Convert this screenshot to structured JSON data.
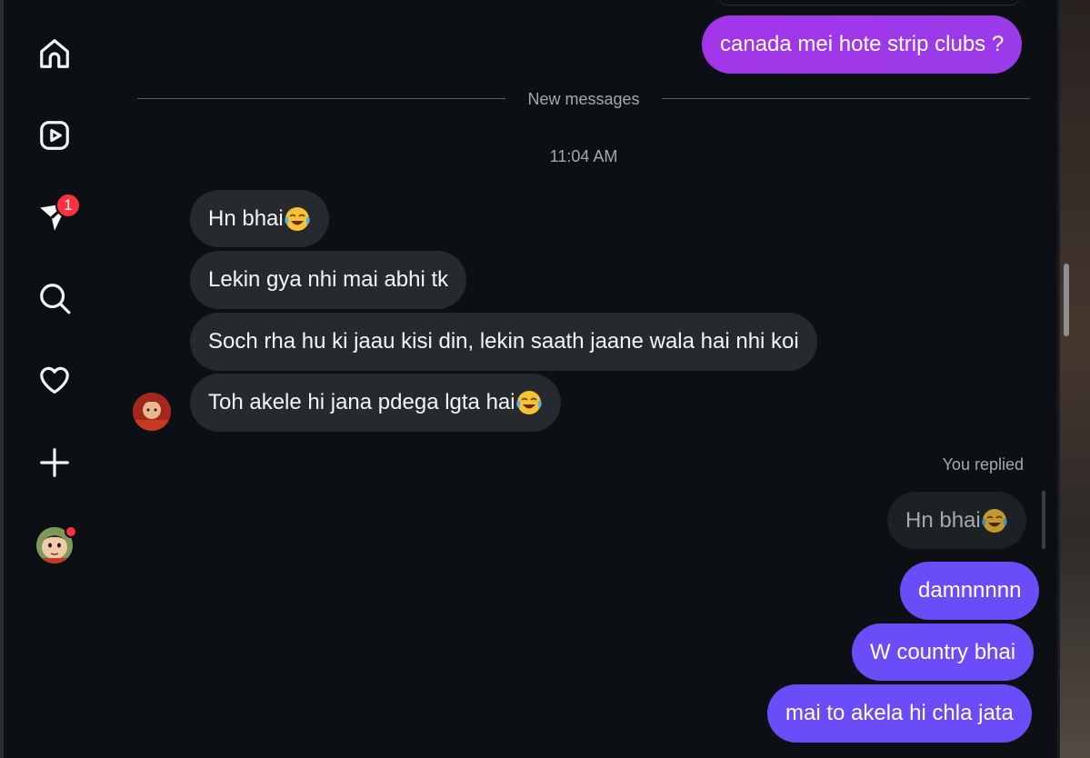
{
  "sidebar": {
    "items": [
      {
        "icon": "home-icon"
      },
      {
        "icon": "reels-icon"
      },
      {
        "icon": "messages-icon",
        "badge": "1"
      },
      {
        "icon": "search-icon"
      },
      {
        "icon": "heart-icon"
      },
      {
        "icon": "create-icon"
      },
      {
        "icon": "profile-avatar"
      }
    ]
  },
  "chat": {
    "sent_top": "canada mei hote strip clubs ?",
    "divider_label": "New messages",
    "timestamp": "11:04 AM",
    "incoming": [
      {
        "text": "Hn bhai",
        "emoji": "face-with-tears-of-joy"
      },
      {
        "text": "Lekin gya nhi mai abhi tk"
      },
      {
        "text": "Soch rha hu ki jaau kisi din, lekin saath jaane wala hai nhi koi"
      },
      {
        "text": "Toh akele hi jana pdega lgta hai",
        "emoji": "face-with-tears-of-joy"
      }
    ],
    "replied_label": "You replied",
    "reply_preview": {
      "text": "Hn bhai",
      "emoji": "face-with-tears-of-joy"
    },
    "outgoing": [
      {
        "text": "damnnnnn"
      },
      {
        "text": "W country bhai"
      },
      {
        "text": "mai to akela hi chla jata"
      }
    ]
  },
  "colors": {
    "background": "#0c1014",
    "incoming_bubble": "#262a2f",
    "outgoing_purple": "#a235e8",
    "outgoing_indigo": "#6a4cf8",
    "badge": "#ff3040",
    "muted_text": "#a8a8a8"
  }
}
